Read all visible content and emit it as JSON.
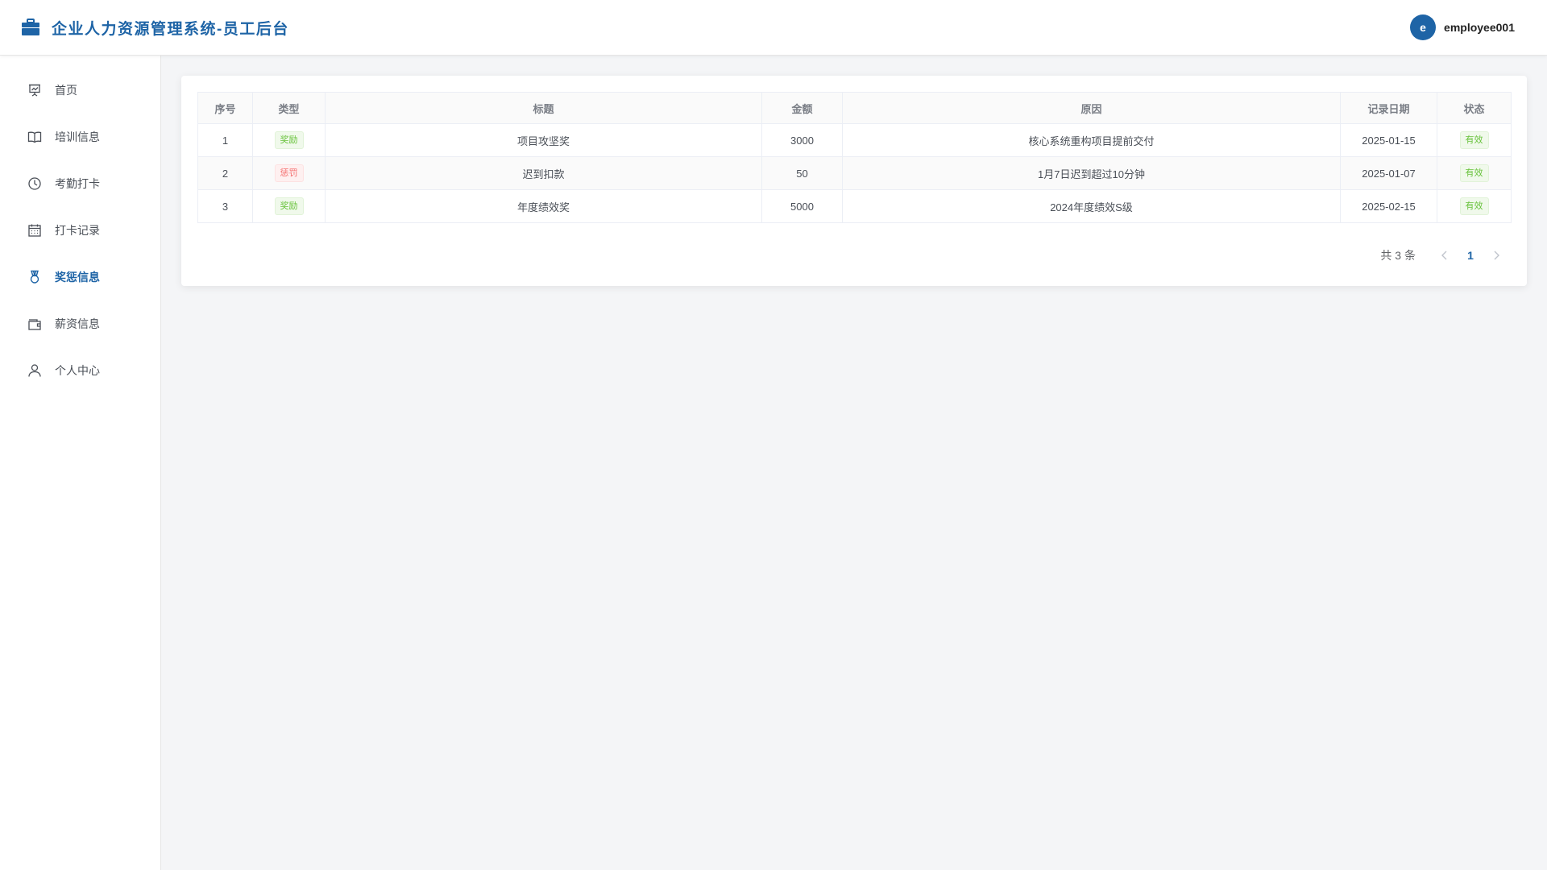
{
  "header": {
    "title": "企业人力资源管理系统-员工后台",
    "avatar_letter": "e",
    "username": "employee001"
  },
  "sidebar": {
    "items": [
      {
        "label": "首页",
        "icon": "presentation-icon"
      },
      {
        "label": "培训信息",
        "icon": "book-icon"
      },
      {
        "label": "考勤打卡",
        "icon": "clock-icon"
      },
      {
        "label": "打卡记录",
        "icon": "calendar-icon"
      },
      {
        "label": "奖惩信息",
        "icon": "medal-icon",
        "active": true
      },
      {
        "label": "薪资信息",
        "icon": "wallet-icon"
      },
      {
        "label": "个人中心",
        "icon": "user-icon"
      }
    ]
  },
  "table": {
    "headers": [
      "序号",
      "类型",
      "标题",
      "金额",
      "原因",
      "记录日期",
      "状态"
    ],
    "rows": [
      {
        "index": "1",
        "type": "奖励",
        "title": "项目攻坚奖",
        "amount": "3000",
        "reason": "核心系统重构项目提前交付",
        "date": "2025-01-15",
        "status": "有效"
      },
      {
        "index": "2",
        "type": "惩罚",
        "title": "迟到扣款",
        "amount": "50",
        "reason": "1月7日迟到超过10分钟",
        "date": "2025-01-07",
        "status": "有效"
      },
      {
        "index": "3",
        "type": "奖励",
        "title": "年度绩效奖",
        "amount": "5000",
        "reason": "2024年度绩效S级",
        "date": "2025-02-15",
        "status": "有效"
      }
    ]
  },
  "pagination": {
    "total_text": "共 3 条",
    "current_page": "1"
  },
  "colors": {
    "accent": "#1e64a6",
    "reward": "#67c23a",
    "penalty": "#f56c6c"
  }
}
